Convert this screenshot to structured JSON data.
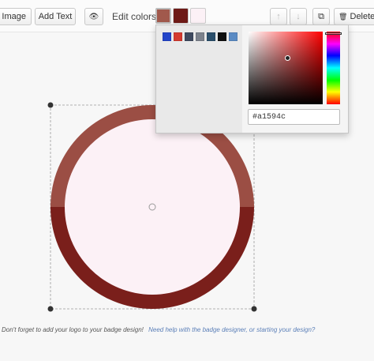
{
  "toolbar": {
    "add_image_label": "d Image",
    "add_text_label": "Add Text",
    "eye_glyph": "👁",
    "edit_colors_label": "Edit colors:",
    "up_glyph": "↑",
    "down_glyph": "↓",
    "copy_glyph": "⧉",
    "delete_glyph": "🗑",
    "delete_label": "Delete",
    "swatches": [
      "#a1594c",
      "#6e1a17",
      "#fcf1f6"
    ]
  },
  "picker": {
    "palette": [
      "#2345c9",
      "#d43a2f",
      "#3f4a5f",
      "#7c828c",
      "#2b4f6b",
      "#0f0f0f",
      "#5b8bc4"
    ],
    "hex_value": "#a1594c"
  },
  "badge": {
    "outer_top_color": "#9b4e44",
    "outer_bottom_color": "#7a1f1b",
    "inner_color": "#fcf1f6"
  },
  "footer": {
    "tip": "Don't forget to add your logo to your badge design!",
    "help_link": "Need help with the badge designer, or starting your design?"
  }
}
